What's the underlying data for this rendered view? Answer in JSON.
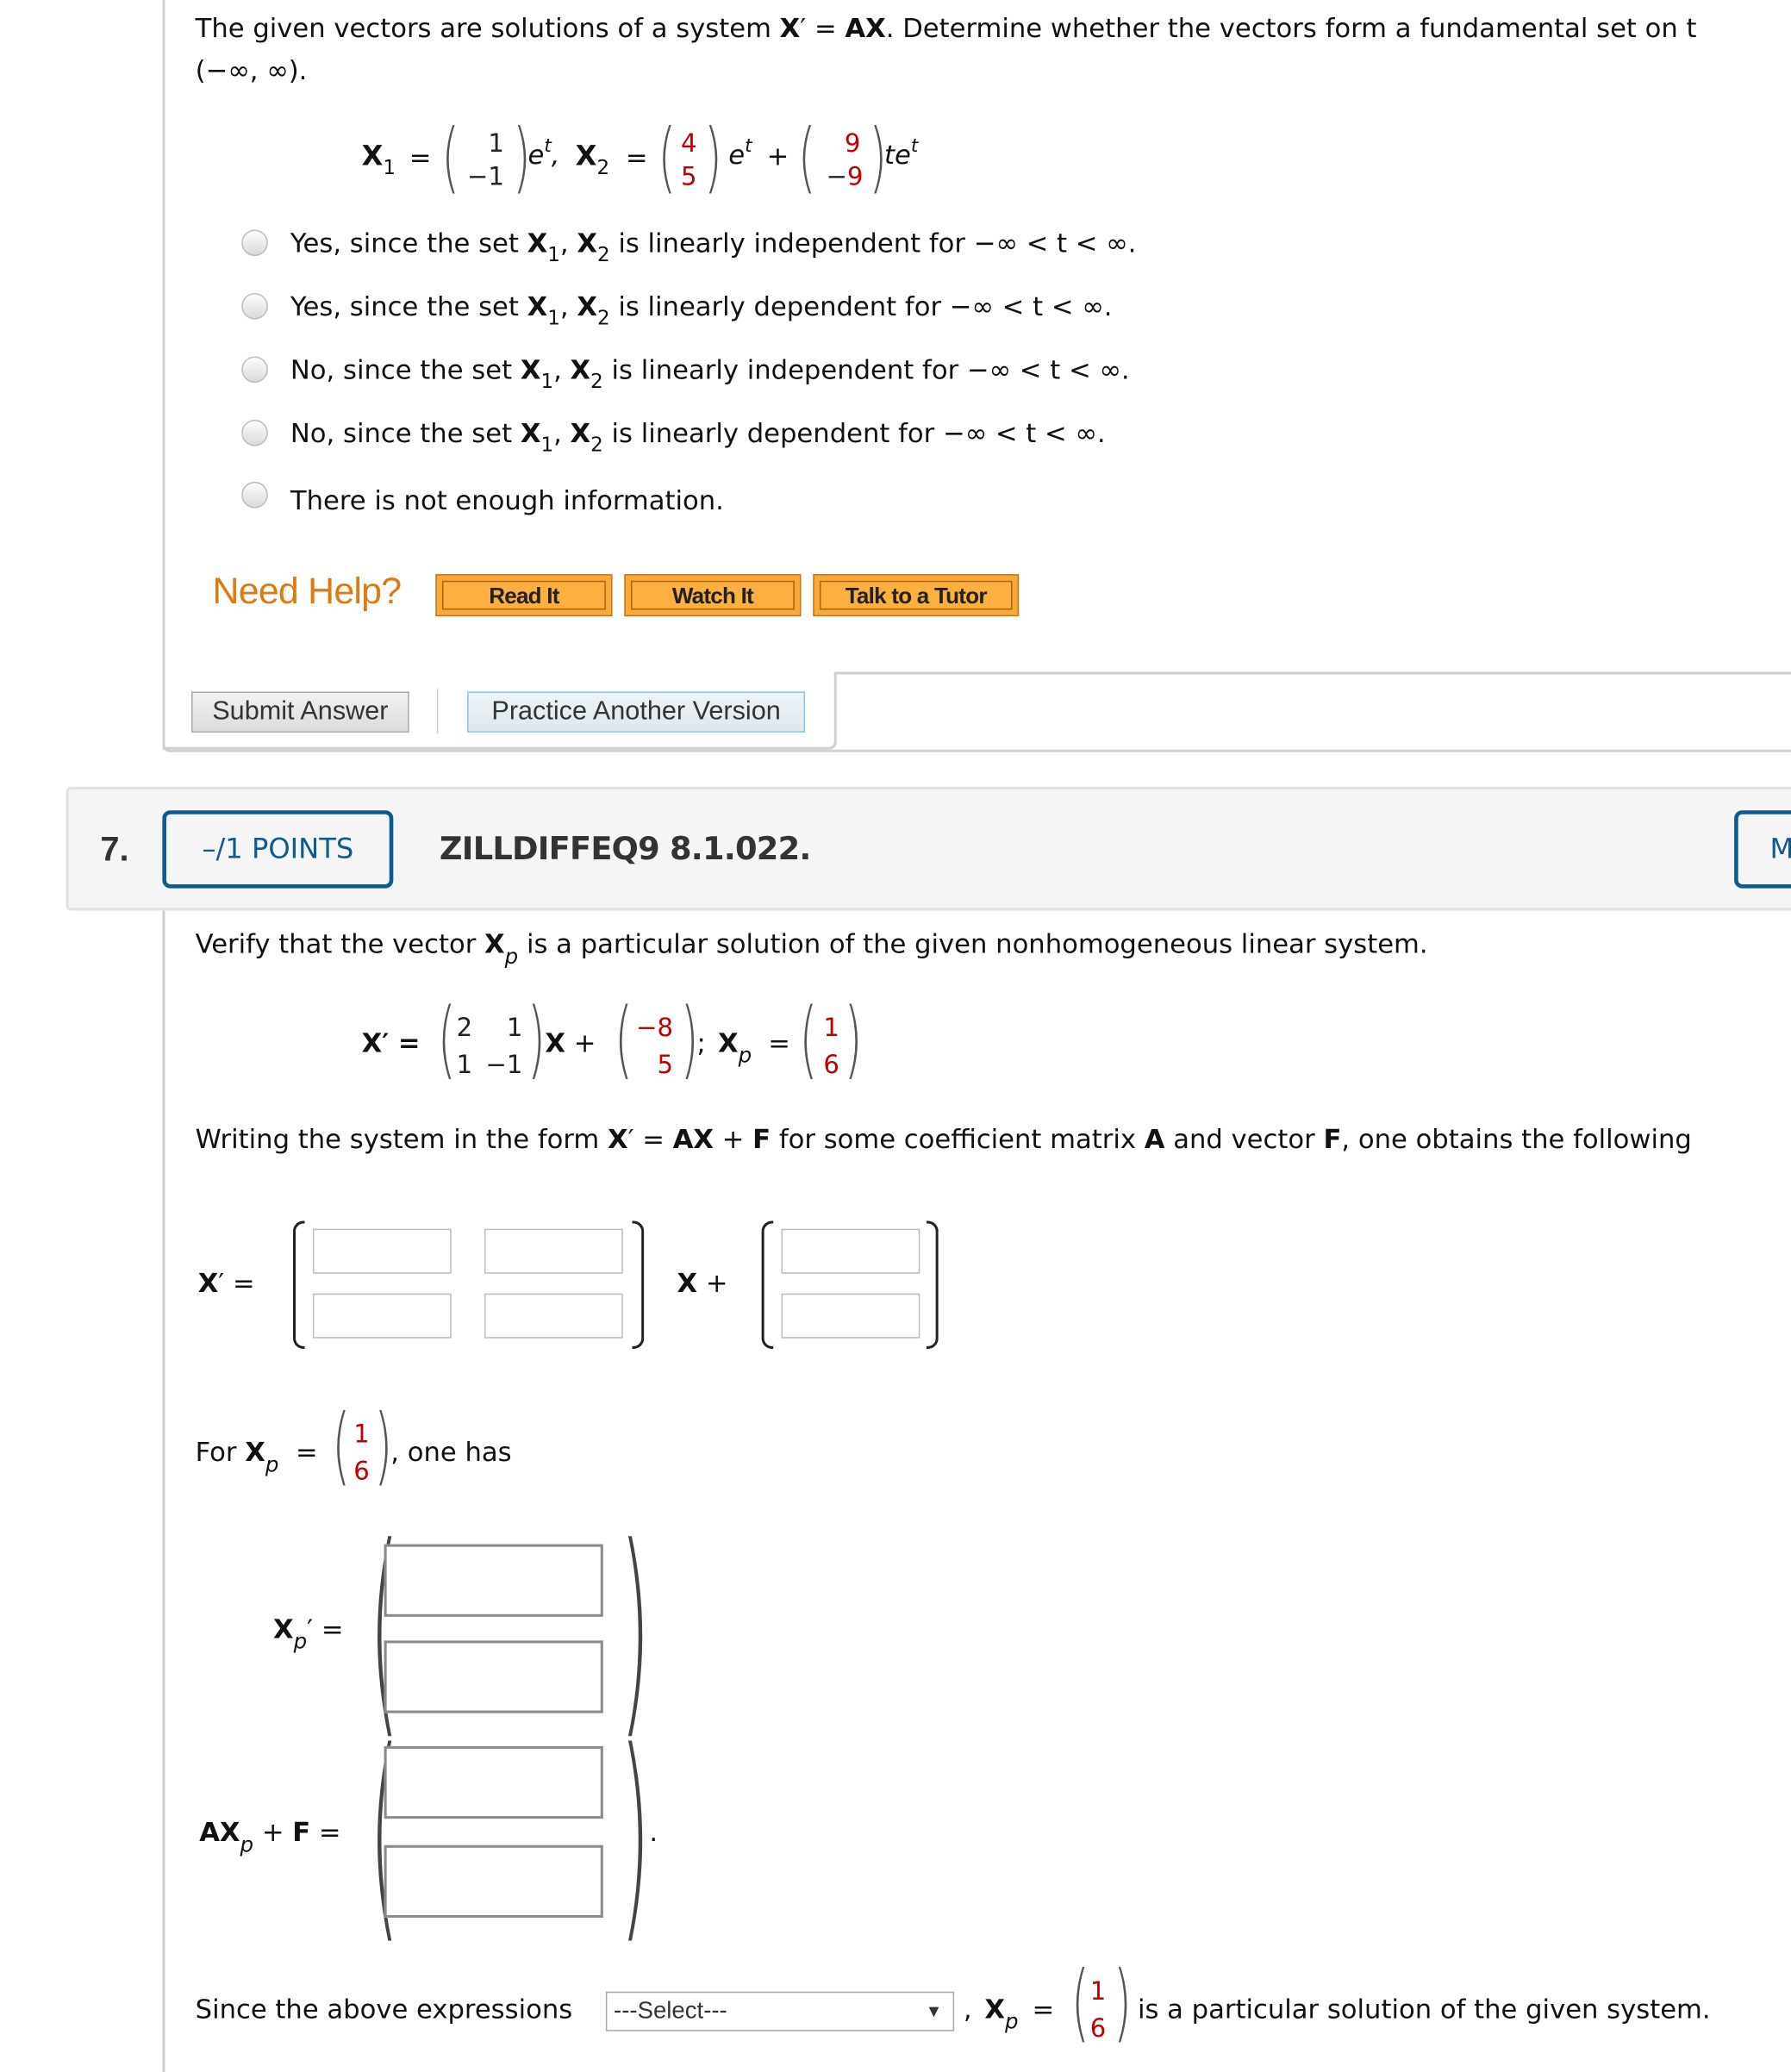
{
  "q6": {
    "prompt_a": "The given vectors are solutions of a system ",
    "prompt_eq_lhs": "X",
    "prompt_prime": "′ = ",
    "prompt_eq_rhs": "AX",
    "prompt_b": ". Determine whether the vectors form a fundamental set on t",
    "prompt_line2": "(−∞, ∞).",
    "equation": {
      "x1_label": "X",
      "x1_sub": "1",
      "x1_vec": [
        "1",
        "−1"
      ],
      "x1_tail": "e",
      "x1_tail_sup": "t",
      "x2_label": "X",
      "x2_sub": "2",
      "x2_vec_a": [
        "4",
        "5"
      ],
      "x2_mid": "e",
      "x2_mid_sup": "t",
      "plus": "+",
      "x2_vec_b_sign": "−",
      "x2_vec_b": [
        "9",
        "9"
      ],
      "x2_tail": "te",
      "x2_tail_sup": "t"
    },
    "options": [
      {
        "pre": "Yes, since the set ",
        "post": " is linearly independent for ",
        "range": "−∞ < t < ∞."
      },
      {
        "pre": "Yes, since the set ",
        "post": " is linearly dependent for ",
        "range": "−∞ < t < ∞."
      },
      {
        "pre": "No, since the set ",
        "post": " is linearly independent for ",
        "range": "−∞ < t < ∞."
      },
      {
        "pre": "No, since the set ",
        "post": " is linearly dependent for ",
        "range": "−∞ < t < ∞."
      },
      {
        "pre": "There is not enough information.",
        "post": "",
        "range": ""
      }
    ],
    "set_x": "X",
    "set_sub1": "1",
    "set_sub2": "2",
    "need_help": "Need Help?",
    "help_buttons": [
      "Read It",
      "Watch It",
      "Talk to a Tutor"
    ],
    "submit": "Submit Answer",
    "practice": "Practice Another Version"
  },
  "q7": {
    "number": "7.",
    "points": "–/1 POINTS",
    "code": "ZILLDIFFEQ9 8.1.022.",
    "my_notes_partial": "M",
    "prompt_a": "Verify that the vector ",
    "prompt_x": "X",
    "prompt_p": "p",
    "prompt_b": " is a particular solution of the given nonhomogeneous linear system.",
    "system": {
      "lhs": "X′ =",
      "A": [
        [
          "2",
          "1"
        ],
        [
          "1",
          "−1"
        ]
      ],
      "x_plus": "X +",
      "F_sign": "−",
      "F": [
        "8",
        "5"
      ],
      "semicolon": ";",
      "xp": "X",
      "xp_sub": "p",
      "eq": "=",
      "xp_vec": [
        "1",
        "6"
      ]
    },
    "form_text_a": "Writing the system in the form ",
    "form_x": "X",
    "form_eq": "′ = ",
    "form_ax": "AX",
    "form_plus": " + ",
    "form_f": "F",
    "form_text_b": " for some coefficient matrix ",
    "form_a": "A",
    "form_text_c": " and vector ",
    "form_f2": "F",
    "form_text_d": ", one obtains the following",
    "entry_lhs_x": "X",
    "entry_lhs_rest": "′ =",
    "entry_mid": "X +",
    "for_text": "For ",
    "for_x": "X",
    "for_sub": "p",
    "for_eq": "=",
    "for_vec": [
      "1",
      "6"
    ],
    "for_tail": ", one has",
    "xpp_x": "X",
    "xpp_sub": "p",
    "xpp_rest": "′ =",
    "axpf_ax": "AX",
    "axpf_sub": "p",
    "axpf_plus": " + ",
    "axpf_f": "F",
    "axpf_eq": " =",
    "period": ".",
    "since_text": "Since the above expressions",
    "select_value": "---Select---",
    "select_arrow": "▼",
    "comma": ",",
    "since_x": "X",
    "since_sub": "p",
    "since_eq": "=",
    "since_vec": [
      "1",
      "6"
    ],
    "since_tail": "is a particular solution of the given system."
  }
}
